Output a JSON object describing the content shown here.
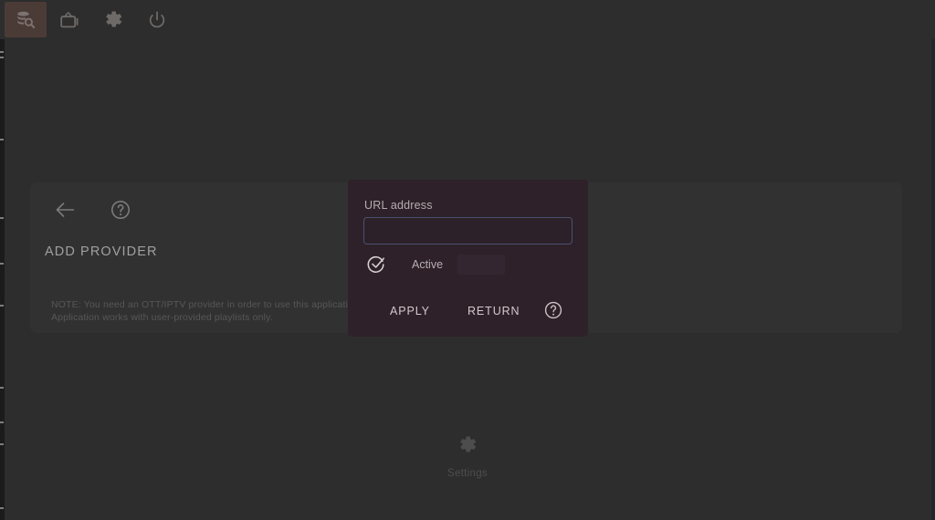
{
  "topbar": {
    "tabs": [
      {
        "id": "providers",
        "icon": "database-search-icon",
        "label": "Providers",
        "active": true
      },
      {
        "id": "tv",
        "icon": "tv-icon",
        "label": "TV",
        "active": false
      },
      {
        "id": "settings",
        "icon": "gear-icon",
        "label": "Settings",
        "active": false
      },
      {
        "id": "power",
        "icon": "power-icon",
        "label": "Power",
        "active": false
      }
    ],
    "active_tab_color": "#4b3b37",
    "background_color": "#2d2d2d"
  },
  "provider_card": {
    "title": "ADD PROVIDER",
    "back_icon": "arrow-left-icon",
    "help_icon": "help-circle-icon",
    "note": "NOTE: You need an OTT/IPTV provider in order to use this application.\nApplication works with user-provided playlists only.",
    "background_color": "#313131"
  },
  "dialog": {
    "url_label": "URL address",
    "url_value": "",
    "url_placeholder": "",
    "checkbox": {
      "label": "Active",
      "checked": true,
      "icon": "check-circle-icon"
    },
    "apply_label": "APPLY",
    "return_label": "RETURN",
    "help_icon": "help-circle-icon",
    "background_color": "#2e2129",
    "input_border_color": "#4a5270"
  },
  "bottom": {
    "settings_label": "Settings",
    "settings_icon": "gear-icon"
  }
}
